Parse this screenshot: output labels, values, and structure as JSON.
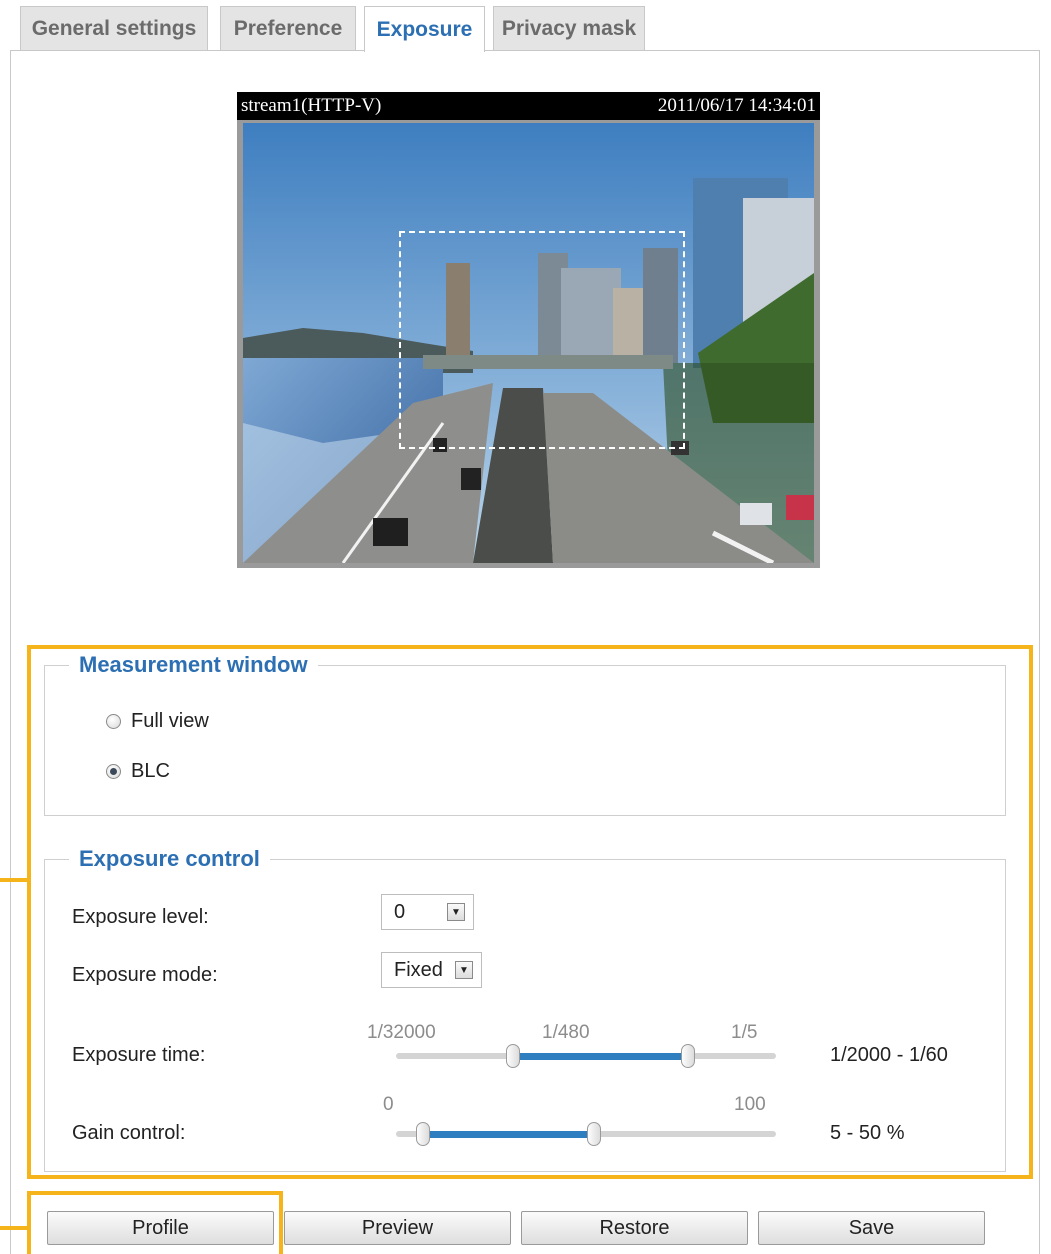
{
  "tabs": [
    {
      "label": "General settings",
      "active": false
    },
    {
      "label": "Preference",
      "active": false
    },
    {
      "label": "Exposure",
      "active": true
    },
    {
      "label": "Privacy mask",
      "active": false
    }
  ],
  "video": {
    "stream_label": "stream1(HTTP-V)",
    "timestamp": "2011/06/17 14:34:01"
  },
  "measurement_window": {
    "legend": "Measurement window",
    "options": [
      {
        "label": "Full view",
        "checked": false
      },
      {
        "label": "BLC",
        "checked": true
      }
    ]
  },
  "exposure_control": {
    "legend": "Exposure control",
    "exposure_level": {
      "label": "Exposure level:",
      "value": "0"
    },
    "exposure_mode": {
      "label": "Exposure mode:",
      "value": "Fixed"
    },
    "exposure_time": {
      "label": "Exposure time:",
      "tick_min": "1/32000",
      "tick_mid": "1/480",
      "tick_max": "1/5",
      "range_text": "1/2000 - 1/60"
    },
    "gain_control": {
      "label": "Gain control:",
      "tick_min": "0",
      "tick_max": "100",
      "range_text": "5 - 50 %",
      "range_low": 5,
      "range_high": 50
    }
  },
  "buttons": {
    "profile": "Profile",
    "preview": "Preview",
    "restore": "Restore",
    "save": "Save"
  },
  "colors": {
    "accent": "#2c6fb3",
    "highlight": "#f4b41a",
    "slider_fill": "#2f7ec0"
  }
}
